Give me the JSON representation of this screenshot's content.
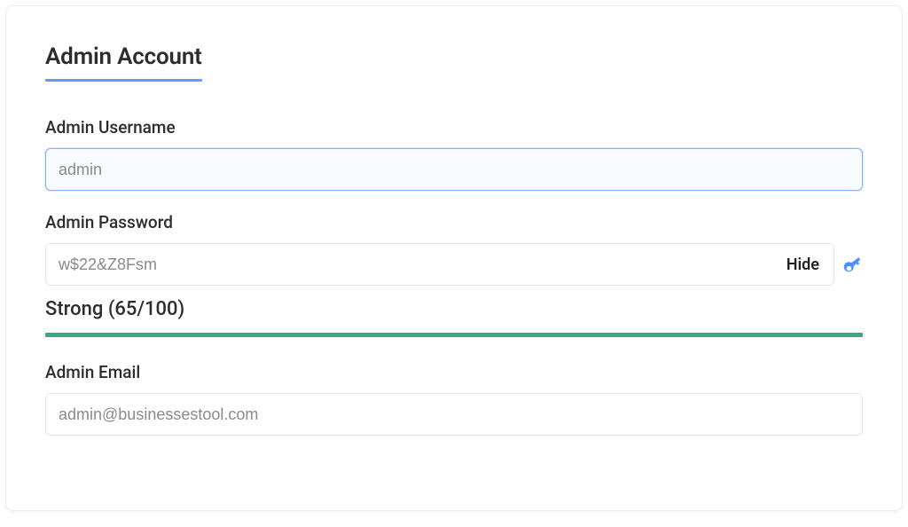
{
  "panel": {
    "title": "Admin Account"
  },
  "fields": {
    "username": {
      "label": "Admin Username",
      "value": "admin"
    },
    "password": {
      "label": "Admin Password",
      "value": "w$22&Z8Fsm",
      "toggle_label": "Hide"
    },
    "strength": {
      "label": "Strong (65/100)"
    },
    "email": {
      "label": "Admin Email",
      "value": "admin@businessestool.com"
    }
  }
}
